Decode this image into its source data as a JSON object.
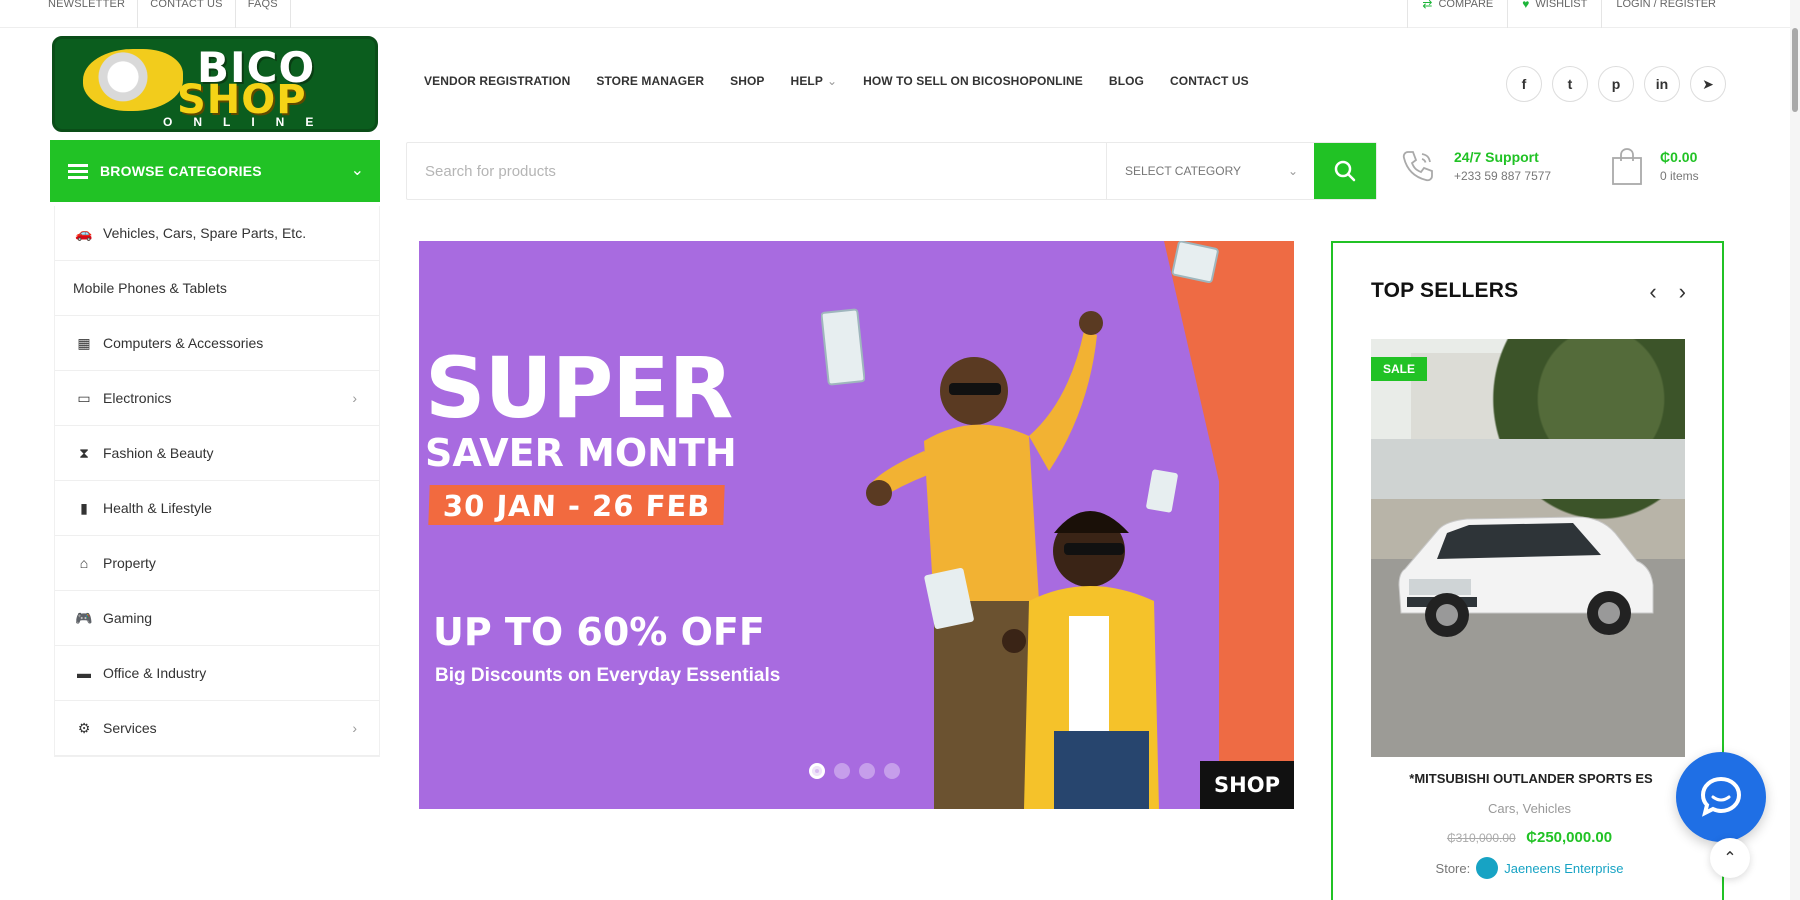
{
  "topbar": {
    "left": [
      "Newsletter",
      "Contact Us",
      "FAQs"
    ],
    "right": [
      {
        "label": "Compare",
        "icon": "compare-icon"
      },
      {
        "label": "Wishlist",
        "icon": "heart-icon"
      },
      {
        "label": "Login / Register",
        "icon": ""
      }
    ]
  },
  "logo": {
    "line1": "BICO",
    "line2": "SHOP",
    "line3": "ONLINE"
  },
  "nav": {
    "items": [
      "Vendor Registration",
      "Store Manager",
      "Shop",
      "Help",
      "How to sell on Bicoshoponline",
      "Blog",
      "Contact Us"
    ],
    "help_chevron": "⌄"
  },
  "social": [
    {
      "icon": "facebook-icon",
      "glyph": "f"
    },
    {
      "icon": "twitter-icon",
      "glyph": "t"
    },
    {
      "icon": "pinterest-icon",
      "glyph": "p"
    },
    {
      "icon": "linkedin-icon",
      "glyph": "in"
    },
    {
      "icon": "telegram-icon",
      "glyph": "➤"
    }
  ],
  "categories": {
    "title": "Browse Categories",
    "toggle": "⌄",
    "items": [
      {
        "label": "Vehicles, Cars, Spare Parts, Etc.",
        "icon": "car-icon",
        "glyph": "🚗",
        "has_sub": false
      },
      {
        "label": "Mobile Phones & Tablets",
        "icon": "",
        "glyph": "",
        "has_sub": false
      },
      {
        "label": "Computers & Accessories",
        "icon": "computer-icon",
        "glyph": "▦",
        "has_sub": false
      },
      {
        "label": "Electronics",
        "icon": "tv-icon",
        "glyph": "▭",
        "has_sub": true
      },
      {
        "label": "Fashion & Beauty",
        "icon": "dress-icon",
        "glyph": "⧗",
        "has_sub": false
      },
      {
        "label": "Health & Lifestyle",
        "icon": "health-icon",
        "glyph": "▮",
        "has_sub": false
      },
      {
        "label": "Property",
        "icon": "property-icon",
        "glyph": "⌂",
        "has_sub": false
      },
      {
        "label": "Gaming",
        "icon": "gamepad-icon",
        "glyph": "🎮",
        "has_sub": false
      },
      {
        "label": "Office & Industry",
        "icon": "office-icon",
        "glyph": "▬",
        "has_sub": false
      },
      {
        "label": "Services",
        "icon": "services-icon",
        "glyph": "⚙",
        "has_sub": true
      }
    ],
    "sub_arrow": "›"
  },
  "search": {
    "placeholder": "Search for products",
    "category": "Select Category",
    "chevron": "⌄"
  },
  "support": {
    "title": "24/7 Support",
    "phone": "+233 59 887 7577"
  },
  "cart": {
    "amount": "₵0.00",
    "items": "0 items"
  },
  "banner": {
    "headline": "SUPER",
    "subheadline": "SAVER MONTH",
    "dates": "30 JAN - 26 FEB",
    "offer": "UP TO 60% OFF",
    "tagline": "Big Discounts on Everyday Essentials",
    "cta": "SHOP",
    "slides": 4,
    "active_slide": 1,
    "colors": {
      "purple": "#a86be0",
      "orange": "#ee6b44"
    }
  },
  "sellers": {
    "title": "TOP SELLERS",
    "prev": "‹",
    "next": "›",
    "product": {
      "badge": "SALE",
      "name": "*MITSUBISHI OUTLANDER SPORTS ES",
      "category": "Cars, Vehicles",
      "old_price": "₵310,000.00",
      "price": "₵250,000.00",
      "store_label": "Store:",
      "store_name": "Jaeneens Enterprise"
    }
  },
  "totop": "⌃",
  "accent_color": "#21c225"
}
